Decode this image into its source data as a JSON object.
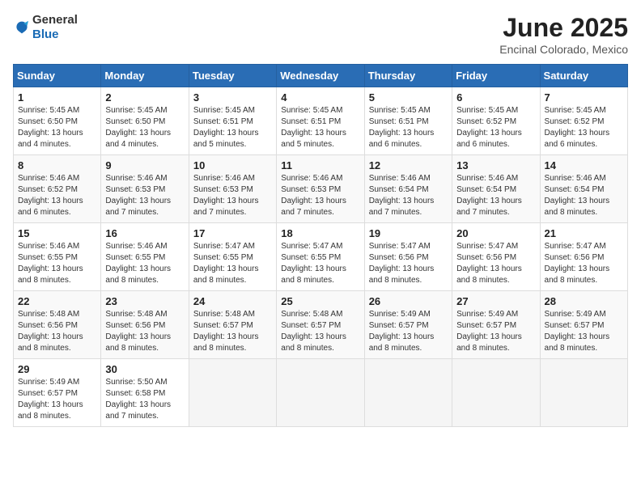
{
  "logo": {
    "general": "General",
    "blue": "Blue"
  },
  "title": "June 2025",
  "location": "Encinal Colorado, Mexico",
  "days_of_week": [
    "Sunday",
    "Monday",
    "Tuesday",
    "Wednesday",
    "Thursday",
    "Friday",
    "Saturday"
  ],
  "weeks": [
    [
      {
        "day": "1",
        "sunrise": "5:45 AM",
        "sunset": "6:50 PM",
        "daylight": "13 hours and 4 minutes."
      },
      {
        "day": "2",
        "sunrise": "5:45 AM",
        "sunset": "6:50 PM",
        "daylight": "13 hours and 4 minutes."
      },
      {
        "day": "3",
        "sunrise": "5:45 AM",
        "sunset": "6:51 PM",
        "daylight": "13 hours and 5 minutes."
      },
      {
        "day": "4",
        "sunrise": "5:45 AM",
        "sunset": "6:51 PM",
        "daylight": "13 hours and 5 minutes."
      },
      {
        "day": "5",
        "sunrise": "5:45 AM",
        "sunset": "6:51 PM",
        "daylight": "13 hours and 6 minutes."
      },
      {
        "day": "6",
        "sunrise": "5:45 AM",
        "sunset": "6:52 PM",
        "daylight": "13 hours and 6 minutes."
      },
      {
        "day": "7",
        "sunrise": "5:45 AM",
        "sunset": "6:52 PM",
        "daylight": "13 hours and 6 minutes."
      }
    ],
    [
      {
        "day": "8",
        "sunrise": "5:46 AM",
        "sunset": "6:52 PM",
        "daylight": "13 hours and 6 minutes."
      },
      {
        "day": "9",
        "sunrise": "5:46 AM",
        "sunset": "6:53 PM",
        "daylight": "13 hours and 7 minutes."
      },
      {
        "day": "10",
        "sunrise": "5:46 AM",
        "sunset": "6:53 PM",
        "daylight": "13 hours and 7 minutes."
      },
      {
        "day": "11",
        "sunrise": "5:46 AM",
        "sunset": "6:53 PM",
        "daylight": "13 hours and 7 minutes."
      },
      {
        "day": "12",
        "sunrise": "5:46 AM",
        "sunset": "6:54 PM",
        "daylight": "13 hours and 7 minutes."
      },
      {
        "day": "13",
        "sunrise": "5:46 AM",
        "sunset": "6:54 PM",
        "daylight": "13 hours and 7 minutes."
      },
      {
        "day": "14",
        "sunrise": "5:46 AM",
        "sunset": "6:54 PM",
        "daylight": "13 hours and 8 minutes."
      }
    ],
    [
      {
        "day": "15",
        "sunrise": "5:46 AM",
        "sunset": "6:55 PM",
        "daylight": "13 hours and 8 minutes."
      },
      {
        "day": "16",
        "sunrise": "5:46 AM",
        "sunset": "6:55 PM",
        "daylight": "13 hours and 8 minutes."
      },
      {
        "day": "17",
        "sunrise": "5:47 AM",
        "sunset": "6:55 PM",
        "daylight": "13 hours and 8 minutes."
      },
      {
        "day": "18",
        "sunrise": "5:47 AM",
        "sunset": "6:55 PM",
        "daylight": "13 hours and 8 minutes."
      },
      {
        "day": "19",
        "sunrise": "5:47 AM",
        "sunset": "6:56 PM",
        "daylight": "13 hours and 8 minutes."
      },
      {
        "day": "20",
        "sunrise": "5:47 AM",
        "sunset": "6:56 PM",
        "daylight": "13 hours and 8 minutes."
      },
      {
        "day": "21",
        "sunrise": "5:47 AM",
        "sunset": "6:56 PM",
        "daylight": "13 hours and 8 minutes."
      }
    ],
    [
      {
        "day": "22",
        "sunrise": "5:48 AM",
        "sunset": "6:56 PM",
        "daylight": "13 hours and 8 minutes."
      },
      {
        "day": "23",
        "sunrise": "5:48 AM",
        "sunset": "6:56 PM",
        "daylight": "13 hours and 8 minutes."
      },
      {
        "day": "24",
        "sunrise": "5:48 AM",
        "sunset": "6:57 PM",
        "daylight": "13 hours and 8 minutes."
      },
      {
        "day": "25",
        "sunrise": "5:48 AM",
        "sunset": "6:57 PM",
        "daylight": "13 hours and 8 minutes."
      },
      {
        "day": "26",
        "sunrise": "5:49 AM",
        "sunset": "6:57 PM",
        "daylight": "13 hours and 8 minutes."
      },
      {
        "day": "27",
        "sunrise": "5:49 AM",
        "sunset": "6:57 PM",
        "daylight": "13 hours and 8 minutes."
      },
      {
        "day": "28",
        "sunrise": "5:49 AM",
        "sunset": "6:57 PM",
        "daylight": "13 hours and 8 minutes."
      }
    ],
    [
      {
        "day": "29",
        "sunrise": "5:49 AM",
        "sunset": "6:57 PM",
        "daylight": "13 hours and 8 minutes."
      },
      {
        "day": "30",
        "sunrise": "5:50 AM",
        "sunset": "6:58 PM",
        "daylight": "13 hours and 7 minutes."
      },
      null,
      null,
      null,
      null,
      null
    ]
  ]
}
